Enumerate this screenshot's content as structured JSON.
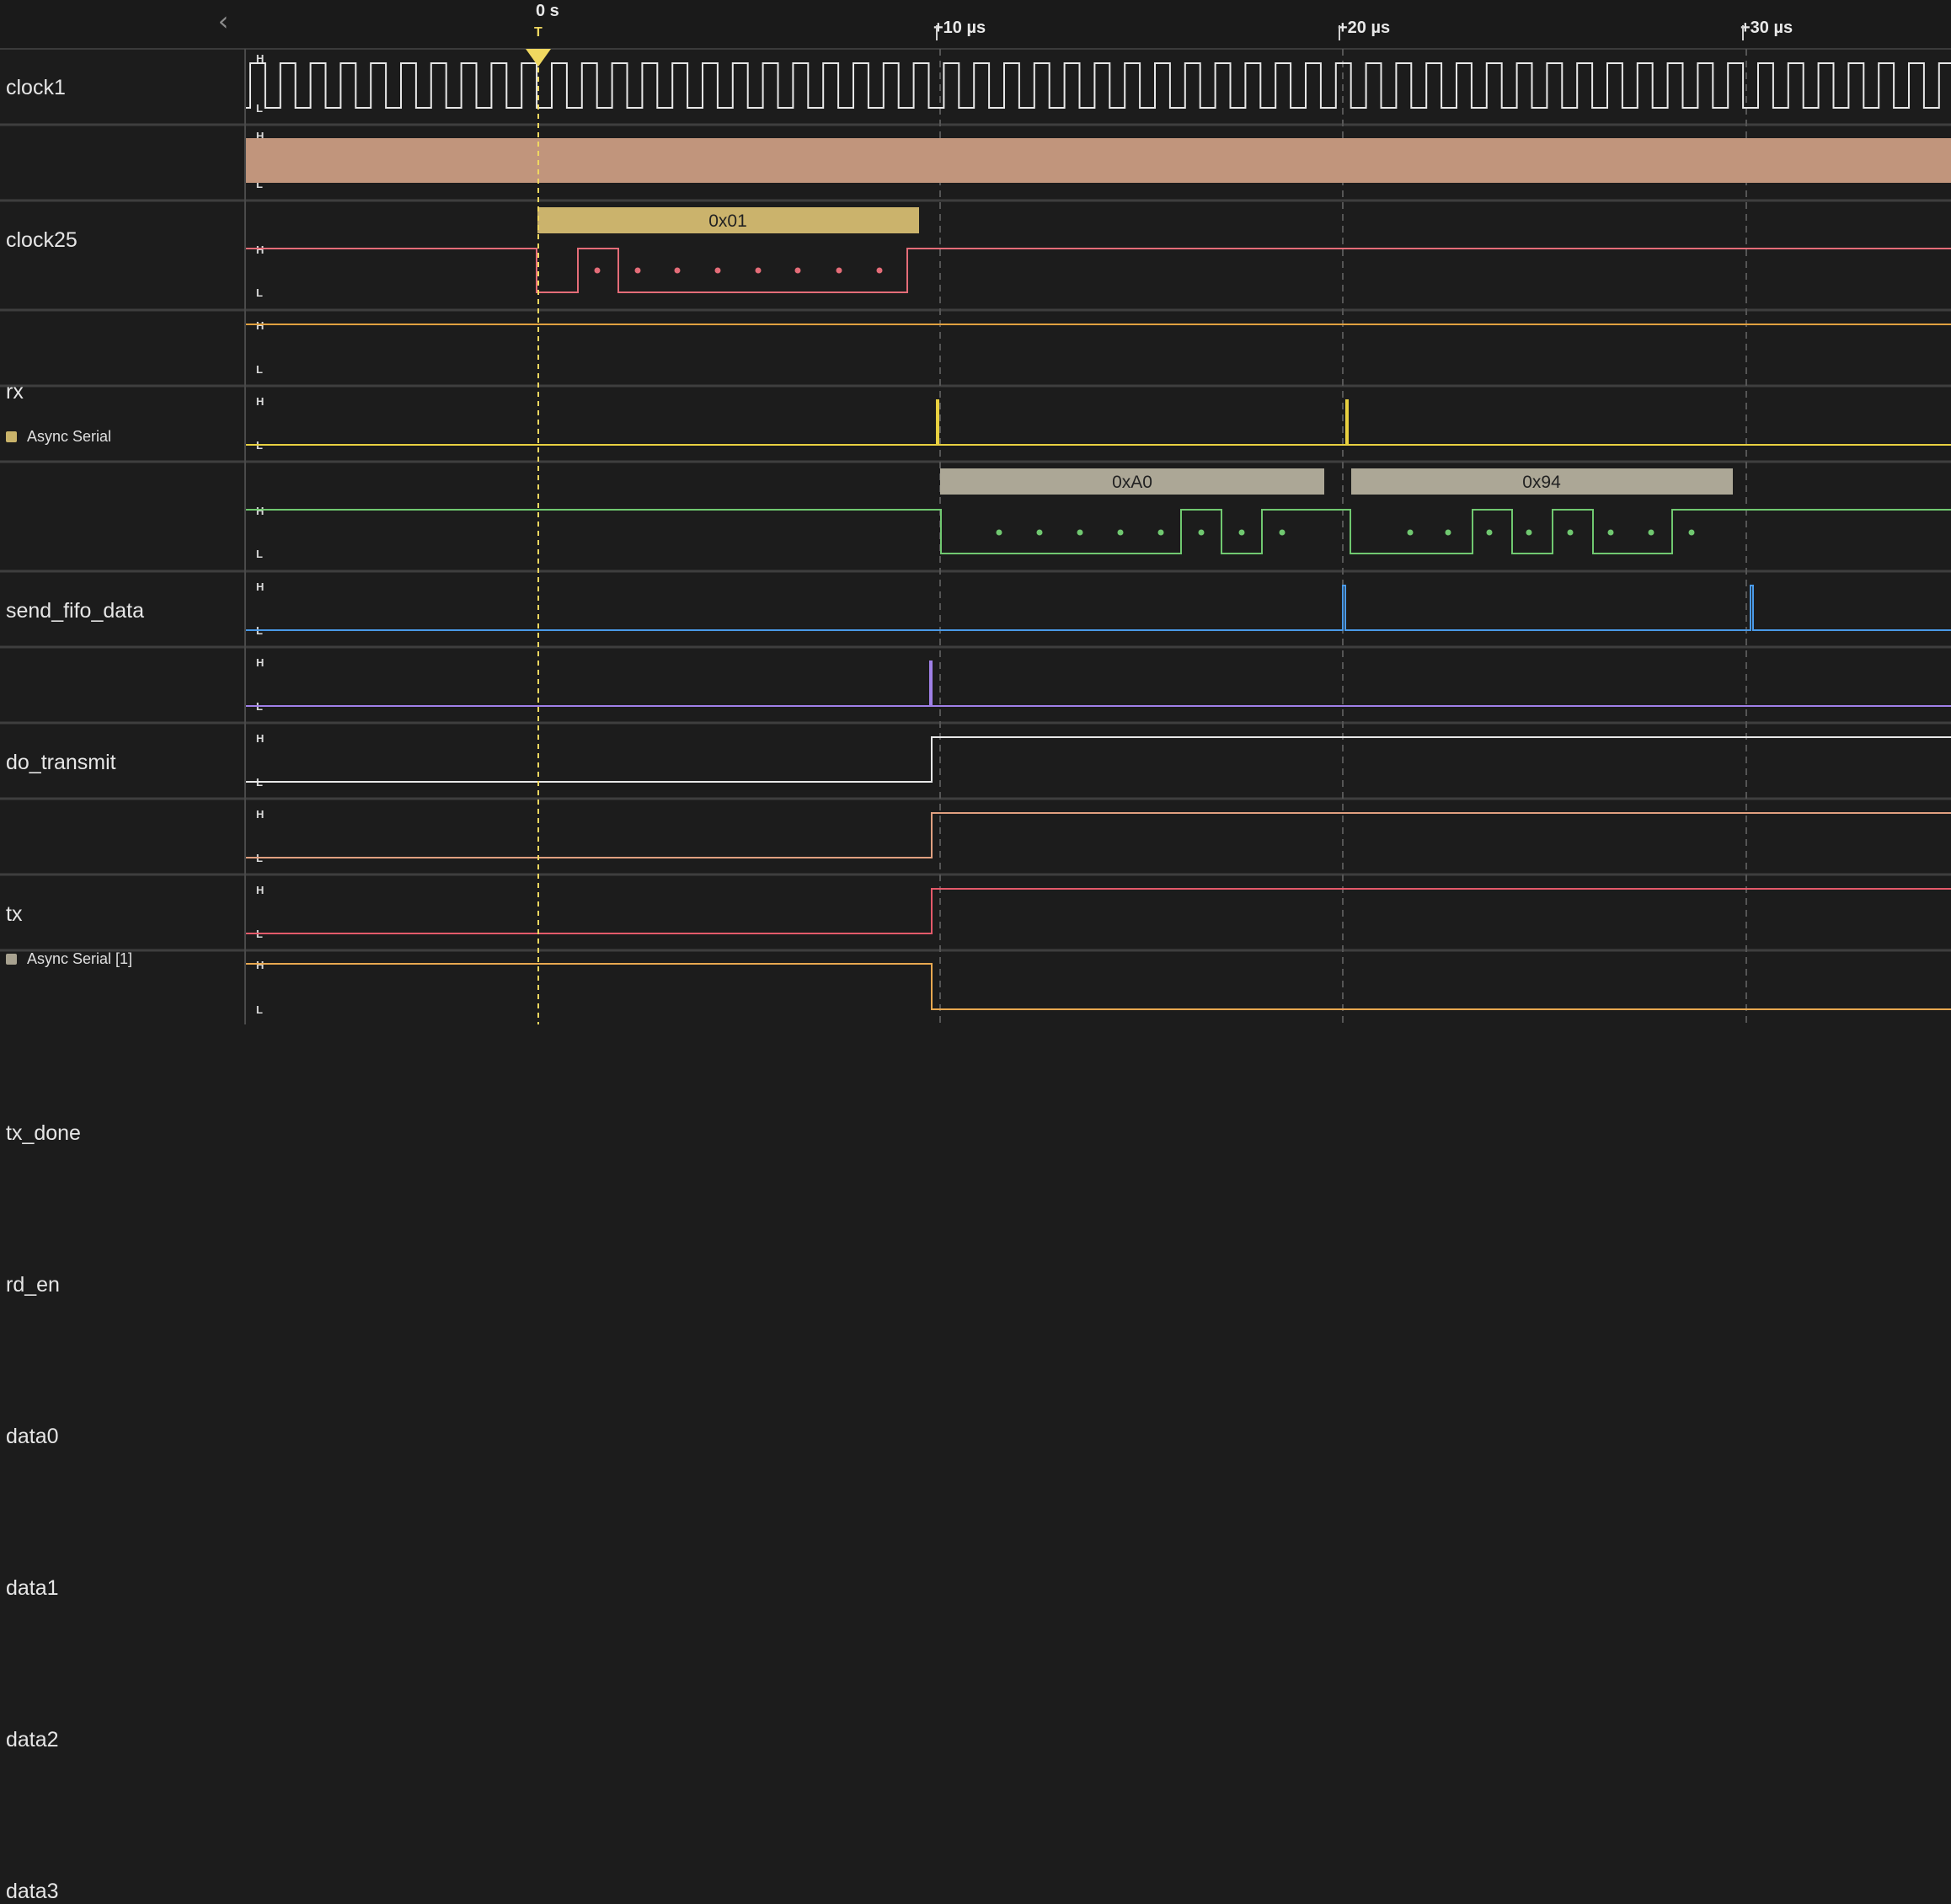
{
  "toolbar": {
    "collapse_icon": "chevron-left-icon"
  },
  "timeline": {
    "origin_label": "0 s",
    "trigger_label": "T",
    "ticks": [
      "+10 µs",
      "+20 µs",
      "+30 µs"
    ]
  },
  "colors": {
    "background": "#1c1c1c",
    "grid": "#555555",
    "trigger_line": "#f0d860",
    "clock1": "#e8e8e8",
    "clock25": "#c1957c",
    "rx": "#e46c78",
    "send_fifo_data": "#e0a040",
    "do_transmit": "#e8d040",
    "tx": "#70c870",
    "tx_done": "#4a9ae8",
    "rd_en": "#a080e8",
    "data0": "#e8e8e8",
    "data1": "#e0a080",
    "data2": "#e45a6a",
    "data3": "#e8a850"
  },
  "channels": [
    {
      "name": "clock1",
      "high": "H",
      "low": "L"
    },
    {
      "name": "clock25",
      "high": "H",
      "low": "L"
    },
    {
      "name": "rx",
      "high": "H",
      "low": "L",
      "analyzer": "Async Serial",
      "analyzer_color": "#c9b36a",
      "frames": [
        {
          "value": "0x01"
        }
      ]
    },
    {
      "name": "send_fifo_data",
      "high": "H",
      "low": "L"
    },
    {
      "name": "do_transmit",
      "high": "H",
      "low": "L"
    },
    {
      "name": "tx",
      "high": "H",
      "low": "L",
      "analyzer": "Async Serial [1]",
      "analyzer_color": "#a8a290",
      "frames": [
        {
          "value": "0xA0"
        },
        {
          "value": "0x94"
        }
      ]
    },
    {
      "name": "tx_done",
      "high": "H",
      "low": "L"
    },
    {
      "name": "rd_en",
      "high": "H",
      "low": "L"
    },
    {
      "name": "data0",
      "high": "H",
      "low": "L"
    },
    {
      "name": "data1",
      "high": "H",
      "low": "L"
    },
    {
      "name": "data2",
      "high": "H",
      "low": "L"
    },
    {
      "name": "data3",
      "high": "H",
      "low": "L"
    }
  ]
}
